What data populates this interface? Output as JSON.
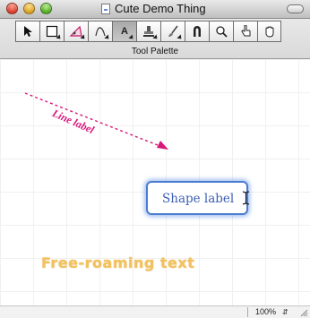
{
  "window": {
    "title": "Cute Demo Thing"
  },
  "palette": {
    "label": "Tool Palette",
    "tools": [
      {
        "name": "select-tool",
        "icon": "arrow-pointer-icon"
      },
      {
        "name": "rectangle-tool",
        "icon": "rectangle-icon"
      },
      {
        "name": "polygon-tool",
        "icon": "polygon-icon"
      },
      {
        "name": "line-tool",
        "icon": "line-icon"
      },
      {
        "name": "text-tool",
        "icon": "text-A-icon",
        "glyph": "A",
        "active": true
      },
      {
        "name": "stamp-tool",
        "icon": "stamp-icon"
      },
      {
        "name": "brush-tool",
        "icon": "brush-icon"
      },
      {
        "name": "magnet-tool",
        "icon": "magnet-icon"
      },
      {
        "name": "zoom-tool",
        "icon": "magnifier-icon"
      },
      {
        "name": "pointing-hand-tool",
        "icon": "pointing-hand-icon"
      },
      {
        "name": "grab-hand-tool",
        "icon": "grab-hand-icon"
      }
    ]
  },
  "canvas": {
    "line_label": "Line label",
    "shape_label": "Shape label",
    "free_text": "Free-roaming text",
    "colors": {
      "line": "#d6197a",
      "shape_border": "#4c7ccf",
      "shape_text": "#3b5fb5",
      "free_text": "#f2c261"
    }
  },
  "status": {
    "zoom": "100%"
  }
}
